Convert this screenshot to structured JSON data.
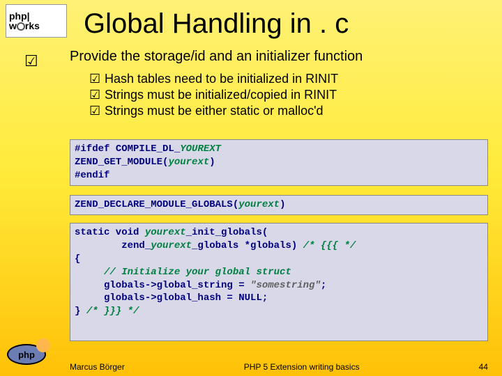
{
  "logo": {
    "line1": "php|",
    "line2_a": "w",
    "line2_b": "rks"
  },
  "title": "Global Handling in . c",
  "main_bullet": "Provide the storage/id and an initializer function",
  "check_glyph": "☑",
  "sub_bullets": [
    "Hash tables need to be initialized in RINIT",
    "Strings must be initialized/copied in RINIT",
    "Strings must be either static or malloc'd"
  ],
  "code1": {
    "l1a": "#ifdef ",
    "l1b": "COMPILE_DL_",
    "l1c": "YOUREXT",
    "l2a": "ZEND_GET_MODULE",
    "l2b": "(",
    "l2c": "yourext",
    "l2d": ")",
    "l3": "#endif"
  },
  "code2": {
    "l1a": "ZEND_DECLARE_MODULE_GLOBALS",
    "l1b": "(",
    "l1c": "yourext",
    "l1d": ")"
  },
  "code3": {
    "l1a": "static void ",
    "l1b": "yourext",
    "l1c": "_init_globals(",
    "l2a": "        zend_",
    "l2b": "yourext",
    "l2c": "_globals *globals) ",
    "l2d": "/* {{{ */",
    "l3": "{",
    "l4": "     // Initialize your global struct",
    "l5a": "     globals->global_string = ",
    "l5b": "\"somestring\"",
    "l5c": ";",
    "l6": "     globals->global_hash = NULL;",
    "l7a": "} ",
    "l7b": "/* }}} */"
  },
  "footer": {
    "author": "Marcus Börger",
    "center": "PHP 5 Extension writing basics",
    "page": "44"
  },
  "php_logo_text": "php"
}
